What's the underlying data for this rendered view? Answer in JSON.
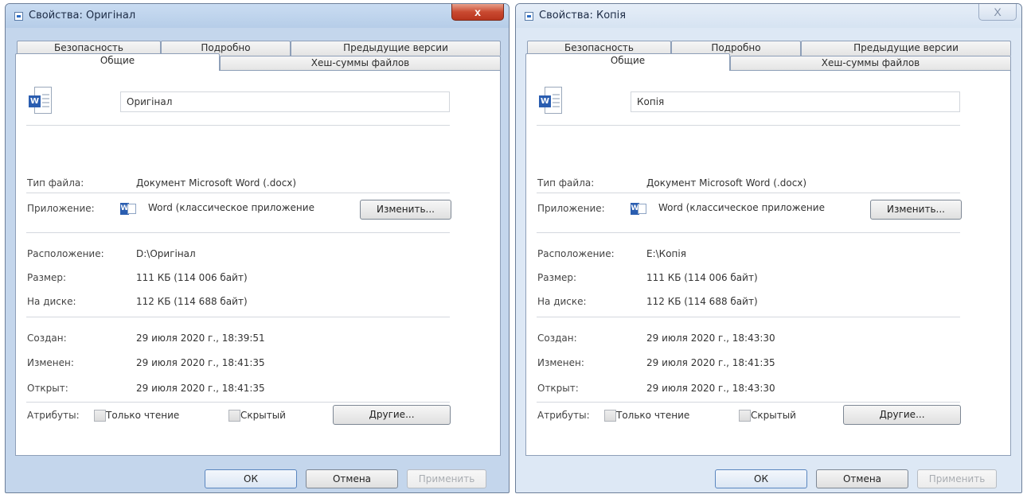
{
  "windows": [
    {
      "title": "Свойства: Оригінал",
      "close_label": "x",
      "tabs": {
        "security": "Безопасность",
        "details": "Подробно",
        "previous": "Предыдущие версии",
        "general": "Общие",
        "hashes": "Хеш-суммы файлов"
      },
      "file_name": "Оригінал",
      "file_icon": "word-document-icon",
      "rows": {
        "type_label": "Тип файла:",
        "type_value": "Документ Microsoft Word (.docx)",
        "app_label": "Приложение:",
        "app_value": "Word (классическое приложение",
        "change_button": "Изменить...",
        "location_label": "Расположение:",
        "location_value": "D:\\Оригінал",
        "size_label": "Размер:",
        "size_value": "111 КБ (114 006 байт)",
        "disk_label": "На диске:",
        "disk_value": "112 КБ (114 688 байт)",
        "created_label": "Создан:",
        "created_value": "29 июля 2020 г., 18:39:51",
        "modified_label": "Изменен:",
        "modified_value": "29 июля 2020 г., 18:41:35",
        "opened_label": "Открыт:",
        "opened_value": "29 июля 2020 г., 18:41:35",
        "attributes_label": "Атрибуты:",
        "readonly_label": "Только чтение",
        "hidden_label": "Скрытый",
        "other_button": "Другие..."
      },
      "buttons": {
        "ok": "ОК",
        "cancel": "Отмена",
        "apply": "Применить"
      }
    },
    {
      "title": "Свойства: Копія",
      "close_label": "X",
      "tabs": {
        "security": "Безопасность",
        "details": "Подробно",
        "previous": "Предыдущие версии",
        "general": "Общие",
        "hashes": "Хеш-суммы файлов"
      },
      "file_name": "Копія",
      "file_icon": "word-document-icon",
      "rows": {
        "type_label": "Тип файла:",
        "type_value": "Документ Microsoft Word (.docx)",
        "app_label": "Приложение:",
        "app_value": "Word (классическое приложение",
        "change_button": "Изменить...",
        "location_label": "Расположение:",
        "location_value": "E:\\Копія",
        "size_label": "Размер:",
        "size_value": "111 КБ (114 006 байт)",
        "disk_label": "На диске:",
        "disk_value": "112 КБ (114 688 байт)",
        "created_label": "Создан:",
        "created_value": "29 июля 2020 г., 18:43:30",
        "modified_label": "Изменен:",
        "modified_value": "29 июля 2020 г., 18:41:35",
        "opened_label": "Открыт:",
        "opened_value": "29 июля 2020 г., 18:43:30",
        "attributes_label": "Атрибуты:",
        "readonly_label": "Только чтение",
        "hidden_label": "Скрытый",
        "other_button": "Другие..."
      },
      "buttons": {
        "ok": "ОК",
        "cancel": "Отмена",
        "apply": "Применить"
      }
    }
  ],
  "colors": {
    "active_titlebar": "#c4d6ec",
    "inactive_titlebar": "#dde8f5",
    "close_button_active": "#c94a31",
    "word_blue": "#2a5db0"
  }
}
